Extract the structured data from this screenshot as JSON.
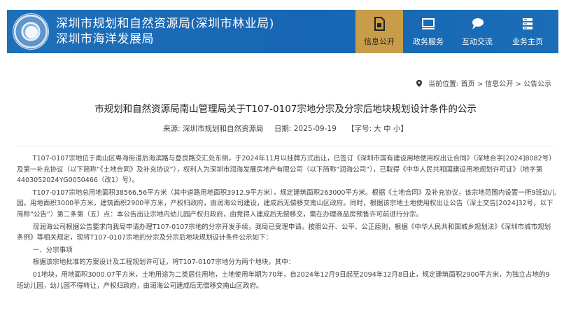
{
  "header": {
    "org_line1": "深圳市规划和自然资源局(深圳市林业局)",
    "org_line2": "深圳市海洋发展局",
    "nav": [
      {
        "label": "信息公开",
        "icon": "document-icon",
        "active": true
      },
      {
        "label": "政务服务",
        "icon": "monitor-icon"
      },
      {
        "label": "互动交流",
        "icon": "chat-icon"
      },
      {
        "label": "业务主页",
        "icon": "server-icon"
      }
    ]
  },
  "breadcrumb": {
    "prefix": "当前位置:",
    "path": "首页 > 信息公开 > 公告公示"
  },
  "article": {
    "title": "市规划和自然资源局南山管理局关于T107-0107宗地分宗及分宗后地块规划设计条件的公示",
    "source": "来源: 深圳市规划和自然资源局",
    "date": "日期: 2025-09-19",
    "fontsize_prefix": "【字号:",
    "fs_large": "大",
    "fs_medium": "中",
    "fs_small": "小",
    "fontsize_suffix": "】",
    "paragraphs": [
      "T107-0107宗地位于南山区粤海街道后海滨路与登良路交汇处东侧，于2024年11月以挂牌方式出让，已签订《深圳市国有建设用地使用权出让合同》（深地合字[2024]8082号）及第一补充协议（以下简称“《土地合同》及补充协议”），权利人为深圳市润海发展房地产有限公司（以下简称“润海公司”），已取得《中华人民共和国建设用地规划许可证》（地字第4403052024YG0050466（改1）号）。",
      "T107-0107宗地总用地面积38566.56平方米（其中道路用地面积3912.9平方米），规定建筑面积263000平方米。根据《土地合同》及补充协议，该宗地范围内设置一所9班幼儿园，用地面积3000平方米，建筑面积2900平方米，产权归政府，由润海公司建设，建成后无偿移交南山区政府。同时，根据该宗地土地使用权出让公告（深土交告[2024]32号，以下简称“公告”）第二条第（五）点：本公告出让宗地内幼儿园产权归政府，由竞得人建成后无偿移交，需在办理商品房预售许可前进行分宗。",
      "现润海公司根据公告要求向我局申请办理T107-0107宗地的分宗开发手续，我局已受理申请。按照公开、公平、公正原则，根据《中华人民共和国城乡规划法》《深圳市城市规划条例》等相关规定，现将T107-0107宗地的分宗及分宗后地块规划设计条件公示如下：",
      "一、分宗事项",
      "根据该宗地批准的方案设计及工程规划许可证，将T107-0107宗地分为两个地块，其中：",
      "01地块，用地面积3000.07平方米，土地用途为二类居住用地，土地使用年期为70年，自2024年12月9日起至2094年12月8日止，规定建筑面积2900平方米，为独立占地的9班幼儿园，幼儿园不得转让，产权归政府，由润海公司建成后无偿移交南山区政府。"
    ]
  },
  "colors": {
    "banner": "#1766b3",
    "active_nav": "#c89d4a"
  }
}
